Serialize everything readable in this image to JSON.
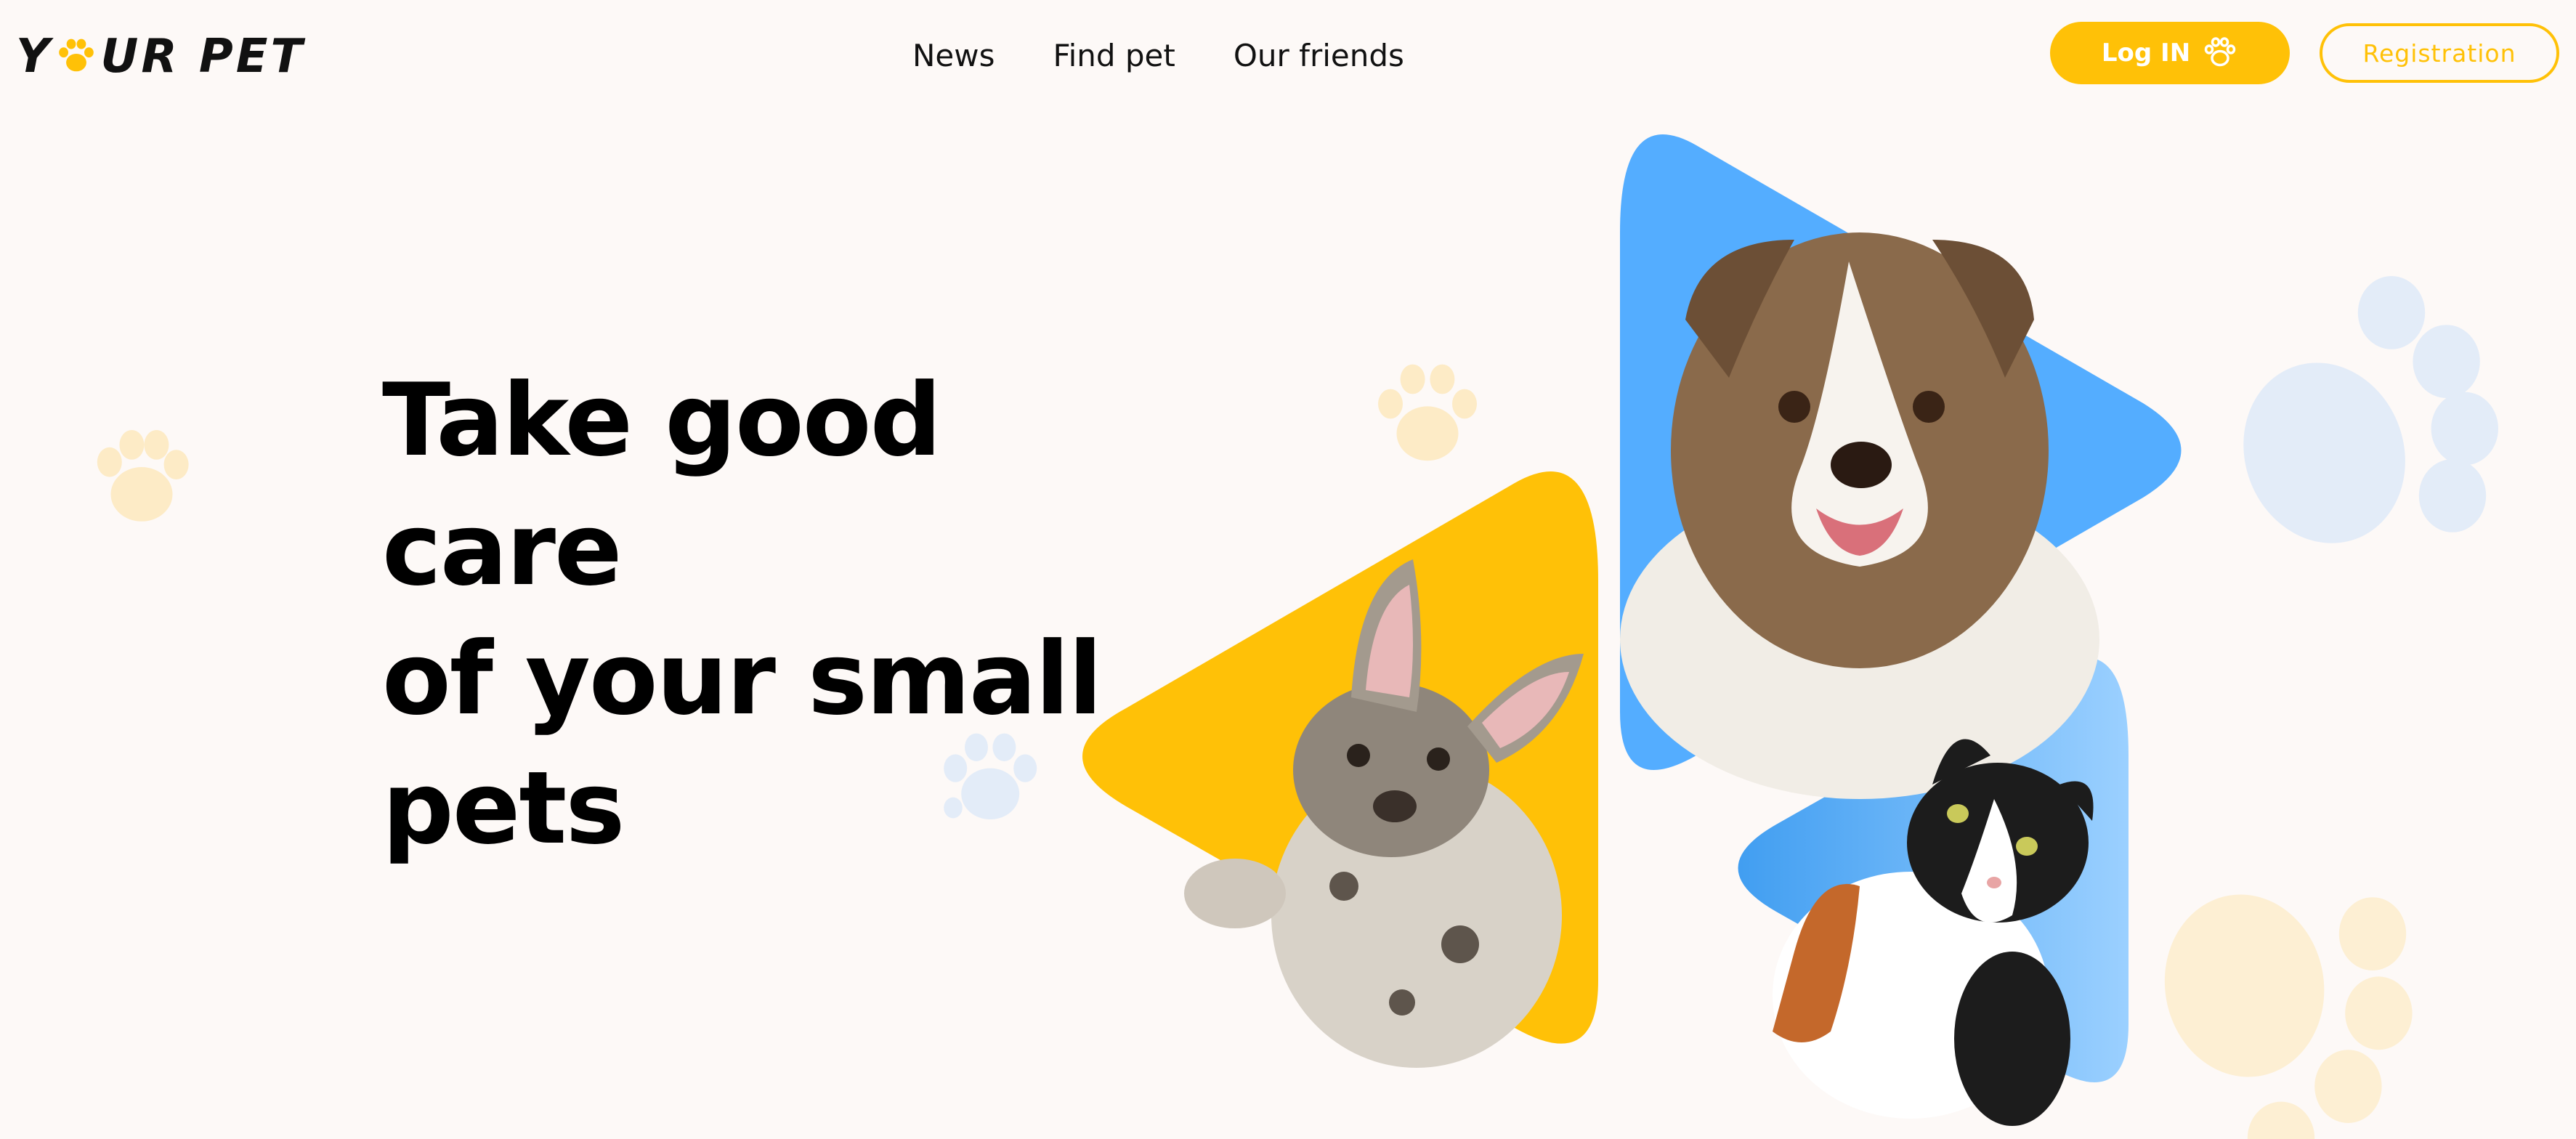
{
  "header": {
    "logo": {
      "prefix": "Y",
      "suffix": "UR PET"
    },
    "nav": {
      "items": [
        {
          "label": "News"
        },
        {
          "label": "Find pet"
        },
        {
          "label": "Our friends"
        }
      ]
    },
    "login_label": "Log IN",
    "register_label": "Registration"
  },
  "hero": {
    "title_lines": [
      "Take good care",
      "of your small",
      "pets"
    ]
  },
  "theme": {
    "accent_yellow": "#FFC107",
    "accent_blue": "#54ADFF",
    "background": "#FDF9F7",
    "text": "#111111"
  },
  "icons": {
    "logo_o": "paw-icon",
    "login": "paw-icon",
    "decorations": "paw-print-icon"
  },
  "images": [
    {
      "name": "dog-photo",
      "description_icon": "dog-icon"
    },
    {
      "name": "puppy-photo",
      "description_icon": "dog-icon"
    },
    {
      "name": "cat-photo",
      "description_icon": "cat-icon"
    }
  ]
}
